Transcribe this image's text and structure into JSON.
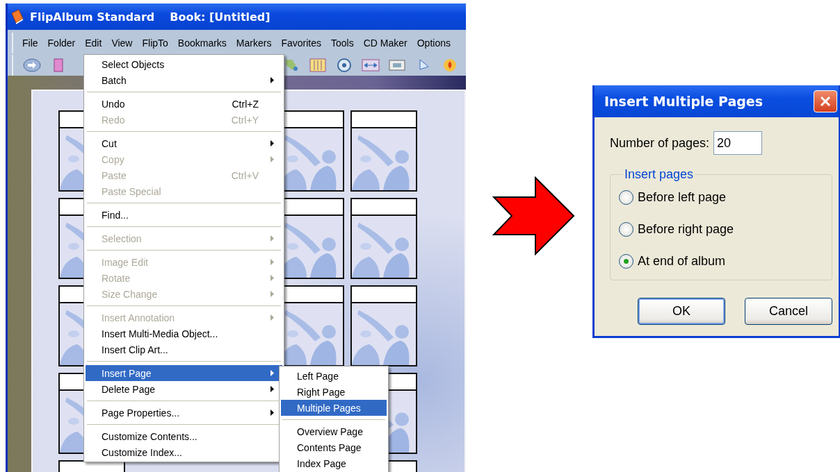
{
  "window": {
    "title": "FlipAlbum Standard",
    "document": "Book: [Untitled]"
  },
  "menubar": [
    {
      "label": "File"
    },
    {
      "label": "Folder"
    },
    {
      "label": "Edit"
    },
    {
      "label": "View"
    },
    {
      "label": "FlipTo"
    },
    {
      "label": "Bookmarks"
    },
    {
      "label": "Markers"
    },
    {
      "label": "Favorites"
    },
    {
      "label": "Tools"
    },
    {
      "label": "CD Maker"
    },
    {
      "label": "Options"
    }
  ],
  "edit_menu": [
    {
      "kind": "item",
      "label": "Select Objects",
      "disabled": false,
      "submenu": false,
      "selected": false
    },
    {
      "kind": "item",
      "label": "Batch",
      "disabled": false,
      "submenu": true,
      "selected": false
    },
    {
      "kind": "separator"
    },
    {
      "kind": "item",
      "label": "Undo",
      "shortcut": "Ctrl+Z",
      "disabled": false,
      "submenu": false,
      "selected": false
    },
    {
      "kind": "item",
      "label": "Redo",
      "shortcut": "Ctrl+Y",
      "disabled": true,
      "submenu": false,
      "selected": false
    },
    {
      "kind": "separator"
    },
    {
      "kind": "item",
      "label": "Cut",
      "disabled": false,
      "submenu": true,
      "selected": false
    },
    {
      "kind": "item",
      "label": "Copy",
      "disabled": true,
      "submenu": true,
      "selected": false
    },
    {
      "kind": "item",
      "label": "Paste",
      "shortcut": "Ctrl+V",
      "disabled": true,
      "submenu": false,
      "selected": false
    },
    {
      "kind": "item",
      "label": "Paste Special",
      "disabled": true,
      "submenu": false,
      "selected": false
    },
    {
      "kind": "separator"
    },
    {
      "kind": "item",
      "label": "Find...",
      "disabled": false,
      "submenu": false,
      "selected": false
    },
    {
      "kind": "separator"
    },
    {
      "kind": "item",
      "label": "Selection",
      "disabled": true,
      "submenu": true,
      "selected": false
    },
    {
      "kind": "separator"
    },
    {
      "kind": "item",
      "label": "Image Edit",
      "disabled": true,
      "submenu": true,
      "selected": false
    },
    {
      "kind": "item",
      "label": "Rotate",
      "disabled": true,
      "submenu": true,
      "selected": false
    },
    {
      "kind": "item",
      "label": "Size Change",
      "disabled": true,
      "submenu": true,
      "selected": false
    },
    {
      "kind": "separator"
    },
    {
      "kind": "item",
      "label": "Insert Annotation",
      "disabled": true,
      "submenu": true,
      "selected": false
    },
    {
      "kind": "item",
      "label": "Insert Multi-Media Object...",
      "disabled": false,
      "submenu": false,
      "selected": false
    },
    {
      "kind": "item",
      "label": "Insert Clip Art...",
      "disabled": false,
      "submenu": false,
      "selected": false
    },
    {
      "kind": "separator"
    },
    {
      "kind": "item",
      "label": "Insert Page",
      "disabled": false,
      "submenu": true,
      "selected": true
    },
    {
      "kind": "item",
      "label": "Delete Page",
      "disabled": false,
      "submenu": true,
      "selected": false
    },
    {
      "kind": "separator"
    },
    {
      "kind": "item",
      "label": "Page Properties...",
      "disabled": false,
      "submenu": true,
      "selected": false
    },
    {
      "kind": "separator"
    },
    {
      "kind": "item",
      "label": "Customize Contents...",
      "disabled": false,
      "submenu": false,
      "selected": false
    },
    {
      "kind": "item",
      "label": "Customize Index...",
      "disabled": false,
      "submenu": false,
      "selected": false
    }
  ],
  "insert_page_menu": [
    {
      "kind": "item",
      "label": "Left Page",
      "selected": false
    },
    {
      "kind": "item",
      "label": "Right Page",
      "selected": false
    },
    {
      "kind": "item",
      "label": "Multiple Pages",
      "selected": true
    },
    {
      "kind": "separator"
    },
    {
      "kind": "item",
      "label": "Overview Page",
      "selected": false
    },
    {
      "kind": "item",
      "label": "Contents Page",
      "selected": false
    },
    {
      "kind": "item",
      "label": "Index Page",
      "selected": false
    }
  ],
  "dialog": {
    "title": "Insert Multiple Pages",
    "field_label": "Number of pages:",
    "field_value": "20",
    "group_label": "Insert pages",
    "options": [
      {
        "label": "Before left page",
        "selected": false
      },
      {
        "label": "Before right page",
        "selected": false
      },
      {
        "label": "At end of album",
        "selected": true
      }
    ],
    "buttons": [
      {
        "label": "OK",
        "default": true
      },
      {
        "label": "Cancel",
        "default": false
      }
    ]
  }
}
